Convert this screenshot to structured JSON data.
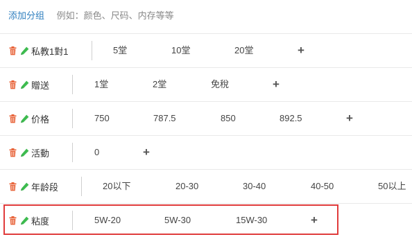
{
  "header": {
    "add_group_label": "添加分组",
    "example_hint": "例如：颜色、尺码、内存等等"
  },
  "icons": {
    "delete": "trash-icon",
    "edit": "pencil-icon"
  },
  "colors": {
    "delete_icon": "#e8643a",
    "edit_icon": "#3dbb4f",
    "link": "#2f7fbf",
    "highlight": "#e03b3b"
  },
  "rows": [
    {
      "name": "私教1對1",
      "values": [
        "5堂",
        "10堂",
        "20堂"
      ],
      "add_label": "+"
    },
    {
      "name": "贈送",
      "values": [
        "1堂",
        "2堂",
        "免稅"
      ],
      "add_label": "+"
    },
    {
      "name": "价格",
      "values": [
        "750",
        "787.5",
        "850",
        "892.5"
      ],
      "add_label": "+"
    },
    {
      "name": "活動",
      "values": [
        "0"
      ],
      "add_label": "+"
    },
    {
      "name": "年龄段",
      "values": [
        "20以下",
        "20-30",
        "30-40",
        "40-50",
        "50以上"
      ]
    },
    {
      "name": "粘度",
      "values": [
        "5W-20",
        "5W-30",
        "15W-30"
      ],
      "add_label": "+"
    }
  ]
}
